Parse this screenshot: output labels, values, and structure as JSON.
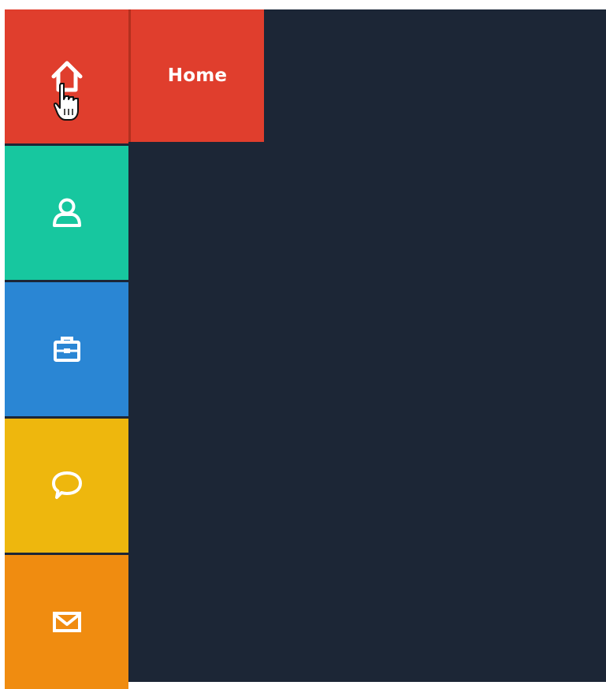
{
  "menu": {
    "items": [
      {
        "icon": "home-icon",
        "label": "Home",
        "color": "#e03e2d",
        "active": true
      },
      {
        "icon": "user-icon",
        "label": "",
        "color": "#17c79f",
        "active": false
      },
      {
        "icon": "briefcase-icon",
        "label": "",
        "color": "#2a86d4",
        "active": false
      },
      {
        "icon": "chat-bubble-icon",
        "label": "",
        "color": "#eeb70d",
        "active": false
      },
      {
        "icon": "envelope-icon",
        "label": "",
        "color": "#f08c10",
        "active": false
      }
    ],
    "tooltip_label": "Home"
  },
  "colors": {
    "background": "#1c2636",
    "home": "#e03e2d",
    "profile": "#17c79f",
    "work": "#2a86d4",
    "chat": "#eeb70d",
    "mail": "#f08c10"
  }
}
